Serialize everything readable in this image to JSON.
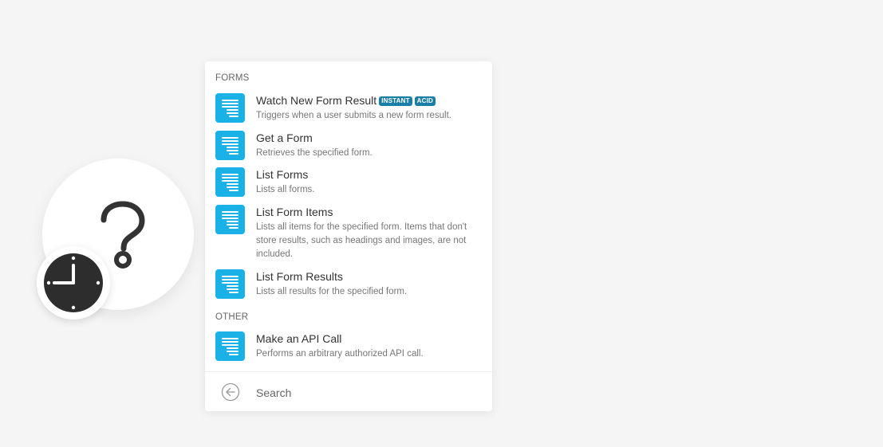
{
  "module": {
    "icon": "question-mark-icon",
    "badge_icon": "clock-icon"
  },
  "picker": {
    "sections": [
      {
        "label": "FORMS",
        "items": [
          {
            "title": "Watch New Form Result",
            "description": "Triggers when a user submits a new form result.",
            "tags": [
              "INSTANT",
              "ACID"
            ]
          },
          {
            "title": "Get a Form",
            "description": "Retrieves the specified form."
          },
          {
            "title": "List Forms",
            "description": "Lists all forms."
          },
          {
            "title": "List Form Items",
            "description": "Lists all items for the specified form. Items that don't store results, such as headings and images, are not included."
          },
          {
            "title": "List Form Results",
            "description": "Lists all results for the specified form."
          }
        ]
      },
      {
        "label": "OTHER",
        "items": [
          {
            "title": "Make an API Call",
            "description": "Performs an arbitrary authorized API call."
          }
        ]
      }
    ],
    "search": {
      "placeholder": "Search",
      "value": ""
    }
  },
  "colors": {
    "background": "#f5f5f6",
    "app_icon": "#1ab1e6",
    "tag": "#1a7fa8"
  }
}
